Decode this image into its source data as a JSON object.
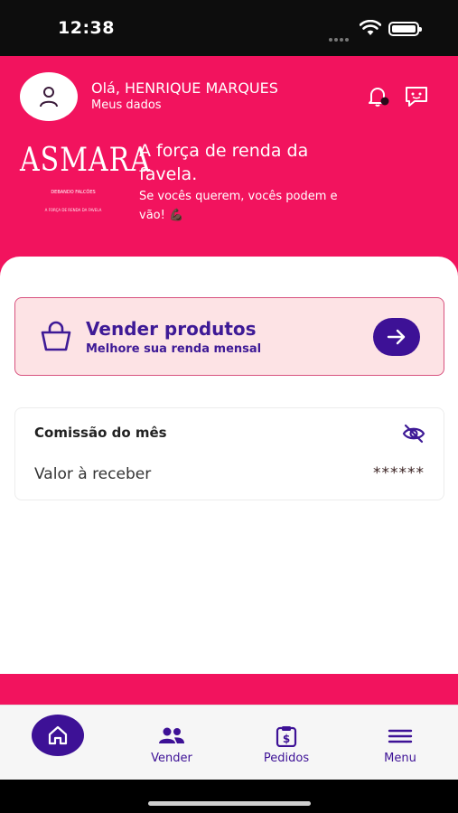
{
  "status_bar": {
    "time": "12:38"
  },
  "header": {
    "greeting": "Olá, HENRIQUE MARQUES",
    "profile_link": "Meus dados",
    "logo": {
      "title": "ASMARA",
      "subtitle": "DEBANDO FALCÕES",
      "tagline_small": "A FORÇA DE RENDA DA FAVELA"
    },
    "tagline": "A força de renda da favela.",
    "tagline_sub": "Se vocês querem, vocês podem e vão! 💪🏿"
  },
  "sell_card": {
    "title": "Vender produtos",
    "subtitle": "Melhore sua renda mensal"
  },
  "commission": {
    "title": "Comissão do mês",
    "value_label": "Valor à receber",
    "value_masked": "******"
  },
  "tabbar": {
    "items": [
      {
        "label": "",
        "icon": "home-icon",
        "active": true
      },
      {
        "label": "Vender",
        "icon": "people-icon"
      },
      {
        "label": "Pedidos",
        "icon": "clipboard-dollar-icon"
      },
      {
        "label": "Menu",
        "icon": "hamburger-icon"
      }
    ]
  },
  "colors": {
    "brand_pink": "#f2135e",
    "brand_purple": "#3d1196",
    "card_pink": "#fde3e5"
  }
}
